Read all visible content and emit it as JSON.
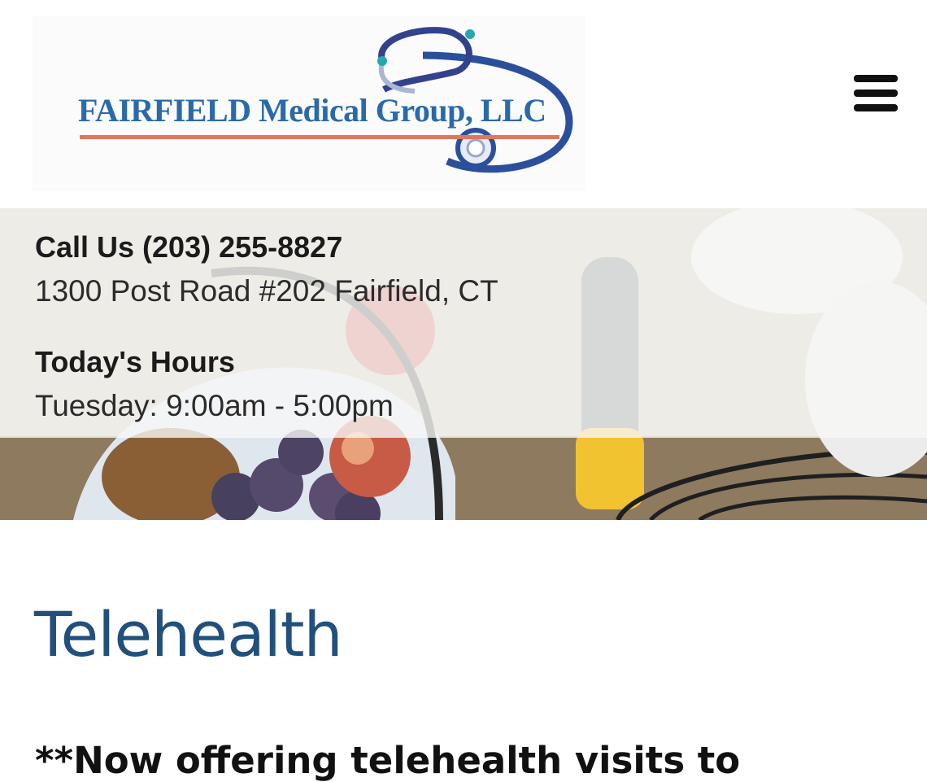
{
  "header": {
    "logo_text": "FAIRFIELD Medical Group, LLC",
    "menu_icon": "hamburger-menu-icon",
    "colors": {
      "logo_blue": "#2a6aa8",
      "logo_underline": "#e0775c",
      "stethoscope": "#2b4f9a"
    }
  },
  "hero": {
    "phone_label": "Call Us (203) 255-8827",
    "address": "1300 Post Road #202 Fairfield, CT",
    "hours_title": "Today's Hours",
    "hours_value": "Tuesday: 9:00am - 5:00pm"
  },
  "main": {
    "title": "Telehealth",
    "announcement": "**Now offering telehealth visits to",
    "title_color": "#21507c"
  }
}
